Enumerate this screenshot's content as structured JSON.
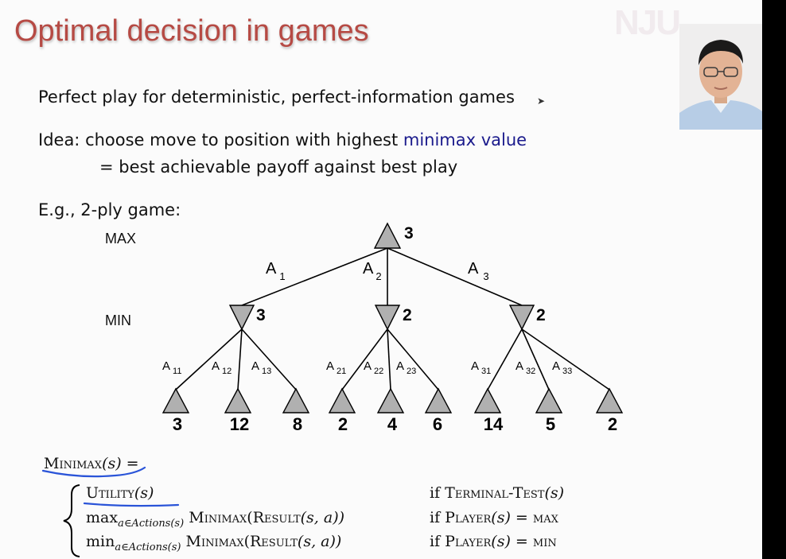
{
  "slide": {
    "title": "Optimal decision in games",
    "logo_text": "NJU",
    "line1": "Perfect play for deterministic, perfect-information games",
    "idea_prefix": "Idea: choose move to position with highest ",
    "idea_highlight": "minimax value",
    "idea_line2": "= best achievable payoff against best play",
    "eg": "E.g., 2-ply game:",
    "colors": {
      "title": "#b64a44",
      "highlight": "#1a1a8c",
      "annotation": "#2a54d8"
    }
  },
  "tree": {
    "max_label": "MAX",
    "min_label": "MIN",
    "root_value": "3",
    "min_nodes": [
      {
        "action": "A",
        "action_sub": "1",
        "value": "3",
        "branches": [
          {
            "a": "A",
            "sub": "11",
            "leaf": "3"
          },
          {
            "a": "A",
            "sub": "12",
            "leaf": "12"
          },
          {
            "a": "A",
            "sub": "13",
            "leaf": "8"
          }
        ]
      },
      {
        "action": "A",
        "action_sub": "2",
        "value": "2",
        "branches": [
          {
            "a": "A",
            "sub": "21",
            "leaf": "2"
          },
          {
            "a": "A",
            "sub": "22",
            "leaf": "4"
          },
          {
            "a": "A",
            "sub": "23",
            "leaf": "6"
          }
        ]
      },
      {
        "action": "A",
        "action_sub": "3",
        "value": "2",
        "branches": [
          {
            "a": "A",
            "sub": "31",
            "leaf": "14"
          },
          {
            "a": "A",
            "sub": "32",
            "leaf": "5"
          },
          {
            "a": "A",
            "sub": "33",
            "leaf": "2"
          }
        ]
      }
    ]
  },
  "formula": {
    "lhs_fn": "Minimax",
    "lhs_arg": "(s) =",
    "case1_fn": "Utility",
    "case1_arg": "(s)",
    "case1_cond_prefix": "if ",
    "case1_cond_fn": "Terminal-Test",
    "case1_cond_arg": "(s)",
    "case2_op": "max",
    "case2_sub": "a∈Actions(s)",
    "case2_fn1": "Minimax",
    "case2_fn2": "Result",
    "case2_args": "(s, a))",
    "case2_cond_prefix": "if ",
    "case2_cond_fn": "Player",
    "case2_cond_arg": "(s) =",
    "case2_cond_val": "max",
    "case3_op": "min",
    "case3_sub": "a∈Actions(s)",
    "case3_fn1": "Minimax",
    "case3_fn2": "Result",
    "case3_args": "(s, a))",
    "case3_cond_prefix": "if ",
    "case3_cond_fn": "Player",
    "case3_cond_arg": "(s) =",
    "case3_cond_val": "min"
  }
}
